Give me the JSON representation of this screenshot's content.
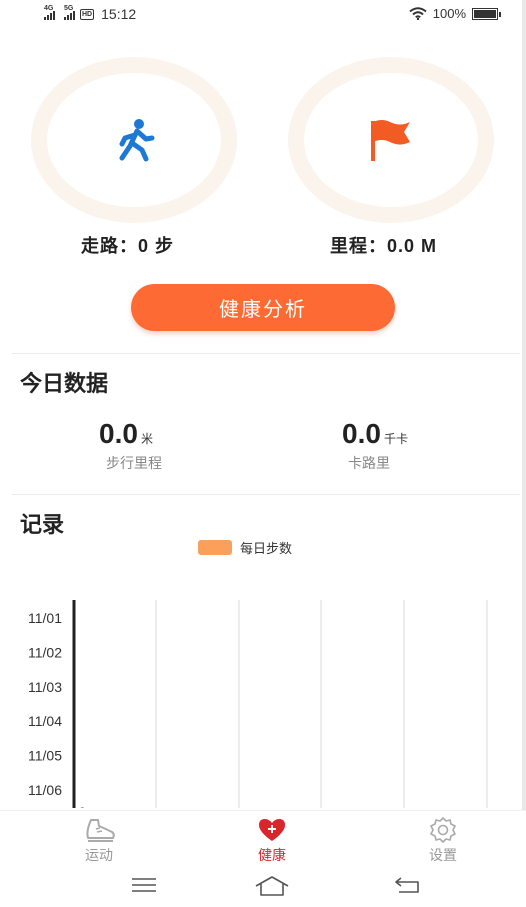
{
  "status_bar": {
    "network1": "4G",
    "network2": "5G",
    "hd": "HD",
    "time": "15:12",
    "battery": "100%"
  },
  "stats": {
    "steps_label": "走路：0 步",
    "distance_label": "里程：0.0 M"
  },
  "analysis_button": "健康分析",
  "today": {
    "title": "今日数据",
    "walk_value": "0.0",
    "walk_unit": "米",
    "walk_label": "步行里程",
    "cal_value": "0.0",
    "cal_unit": "千卡",
    "cal_label": "卡路里"
  },
  "records": {
    "title": "记录"
  },
  "chart_data": {
    "type": "bar",
    "orientation": "horizontal",
    "categories": [
      "11/01",
      "11/02",
      "11/03",
      "11/04",
      "11/05",
      "11/06"
    ],
    "series": [
      {
        "name": "每日步数",
        "values": [
          0,
          0,
          0,
          0,
          0,
          0
        ]
      }
    ],
    "x_tick_visible": "0",
    "grid": true,
    "legend": "top-center",
    "colors": {
      "series": "#fba05a",
      "axis": "#222222",
      "grid": "#d8d8d8"
    }
  },
  "bottom_nav": {
    "items": [
      {
        "label": "运动",
        "icon": "shoe-icon"
      },
      {
        "label": "健康",
        "icon": "heart-plus-icon"
      },
      {
        "label": "设置",
        "icon": "gear-icon"
      }
    ],
    "active_color": "#d8262c"
  },
  "colors": {
    "accent": "#fd6a33",
    "walker_icon": "#1e78d6",
    "flag_icon": "#f35b25",
    "ring": "#fbf4ec"
  }
}
